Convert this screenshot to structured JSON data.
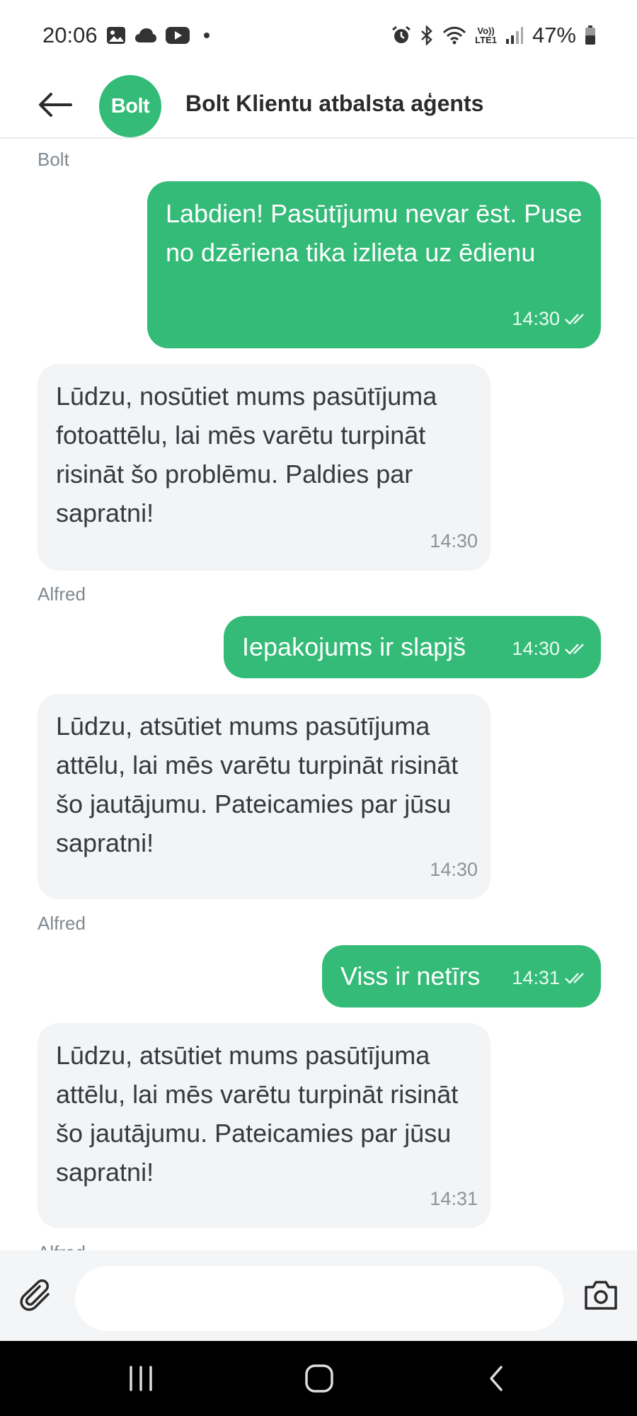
{
  "status_bar": {
    "time": "20:06",
    "volte_line1": "Vo))",
    "volte_line2": "LTE1",
    "battery": "47%"
  },
  "header": {
    "avatar_text": "Bolt",
    "title": "Bolt Klientu atbalsta aģents"
  },
  "messages": [
    {
      "sender": "Bolt"
    },
    {
      "direction": "out",
      "text": "Labdien! Pasūtījumu nevar ēst. Puse no dzēriena tika izlieta uz ēdienu",
      "time": "14:30"
    },
    {
      "direction": "in",
      "text": "Lūdzu, nosūtiet mums pasūtījuma fotoattēlu, lai mēs varētu turpināt risināt šo problēmu. Paldies par sapratni!",
      "time": "14:30"
    },
    {
      "sender": "Alfred"
    },
    {
      "direction": "out",
      "text": "Iepakojums ir slapjš",
      "time": "14:30"
    },
    {
      "direction": "in",
      "text": "Lūdzu, atsūtiet mums pasūtījuma attēlu, lai mēs varētu turpināt risināt šo jautājumu. Pateicamies par jūsu sapratni!",
      "time": "14:30"
    },
    {
      "sender": "Alfred"
    },
    {
      "direction": "out",
      "text": "Viss ir netīrs",
      "time": "14:31"
    },
    {
      "direction": "in",
      "text": "Lūdzu, atsūtiet mums pasūtījuma attēlu, lai mēs varētu turpināt risināt šo jautājumu. Pateicamies par jūsu sapratni!",
      "time": "14:31"
    },
    {
      "sender": "Alfred"
    }
  ],
  "input": {
    "value": "",
    "placeholder": ""
  },
  "colors": {
    "accent": "#34bb78",
    "incoming_bubble": "#f2f4f6",
    "nav_bar": "#000000"
  }
}
